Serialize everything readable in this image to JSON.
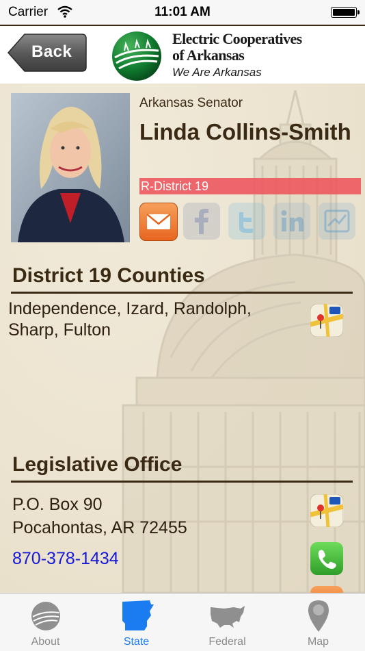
{
  "status": {
    "carrier": "Carrier",
    "time": "11:01 AM"
  },
  "header": {
    "back_label": "Back",
    "logo_line1": "Electric Cooperatives",
    "logo_line2": "of Arkansas",
    "logo_tagline": "We Are Arkansas"
  },
  "profile": {
    "role": "Arkansas Senator",
    "name": "Linda Collins-Smith",
    "district": "R-District 19",
    "social_icons": [
      "email-icon",
      "facebook-icon",
      "twitter-icon",
      "linkedin-icon",
      "website-icon"
    ]
  },
  "counties": {
    "heading": "District 19 Counties",
    "line1": "Independence, Izard, Randolph,",
    "line2": "Sharp, Fulton"
  },
  "office": {
    "heading": "Legislative Office",
    "address_line1": "P.O. Box 90",
    "address_line2": "Pocahontas, AR 72455",
    "phone": "870-378-1434"
  },
  "tabs": [
    {
      "label": "About",
      "icon": "globe-icon"
    },
    {
      "label": "State",
      "icon": "arkansas-map-icon"
    },
    {
      "label": "Federal",
      "icon": "usa-map-icon"
    },
    {
      "label": "Map",
      "icon": "map-pin-icon"
    }
  ],
  "colors": {
    "brown": "#3a2a14",
    "accent_red": "#ec545c",
    "link_blue": "#1518d9",
    "tab_active": "#1a7cf0"
  }
}
